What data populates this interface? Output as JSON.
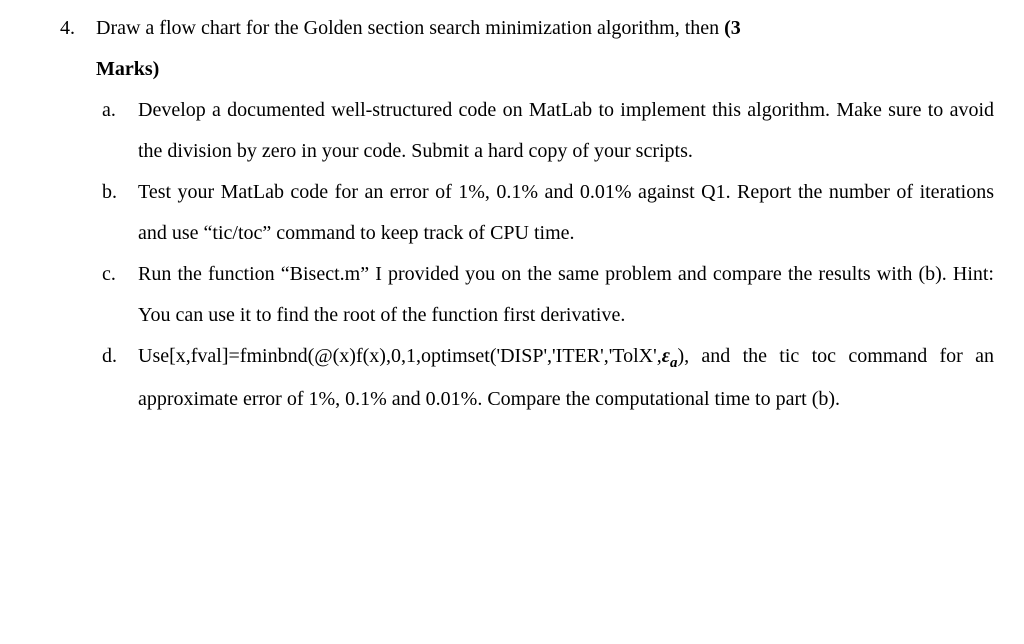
{
  "question": {
    "number": "4.",
    "intro_part1": "Draw a flow chart for the Golden section search minimization algorithm, then ",
    "marks_prefix": "(3",
    "marks_line2": "Marks)",
    "items": {
      "a": {
        "label": "a.",
        "text": "Develop a documented well-structured code on MatLab to implement this algorithm. Make sure to avoid the division by zero in your code. Submit a hard copy of your scripts."
      },
      "b": {
        "label": "b.",
        "text": "Test your MatLab code for an error of 1%, 0.1% and 0.01% against Q1. Report the number of iterations and use “tic/toc” command to keep track of CPU time."
      },
      "c": {
        "label": "c.",
        "text": "Run the function “Bisect.m” I provided you on the same problem and compare the results with (b). Hint: You can use it to find the root of the function first derivative."
      },
      "d": {
        "label": "d.",
        "lead": "Use[x,fval]=fminbnd(@(x)f(x),0,1,optimset('DISP','ITER','TolX',",
        "eps": "ε",
        "sub": "a",
        "tail1": "), and the tic",
        "tail2": "toc command for an approximate error of 1%, 0.1% and 0.01%. Compare the computational time to part (b)."
      }
    }
  }
}
